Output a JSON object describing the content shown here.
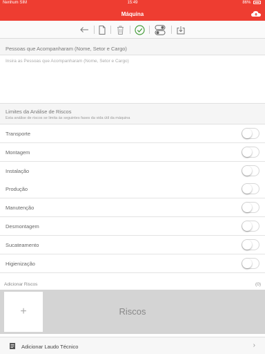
{
  "status_bar": {
    "carrier": "Nenhum SIM",
    "time": "15:49",
    "battery": "86%"
  },
  "nav": {
    "title": "Máquina",
    "cloud_icon": "cloud-upload-icon"
  },
  "toolbar": {
    "icons": [
      "arrow-left-icon",
      "document-icon",
      "trash-icon",
      "checkmark-icon",
      "toggles-icon",
      "download-icon"
    ]
  },
  "people_section": {
    "title": "Pessoas que Acompanharam (Nome, Setor e Cargo)",
    "placeholder": "Insira as Pessoas que Acompanharam (Nome, Setor e Cargo)",
    "value": ""
  },
  "limits_section": {
    "title": "Limites da Análise de Riscos",
    "subtitle": "Esta análise de riscos se limita às seguintes fases da vida útil da máquina"
  },
  "phases": [
    {
      "label": "Transporte",
      "on": false
    },
    {
      "label": "Montagem",
      "on": false
    },
    {
      "label": "Instalação",
      "on": false
    },
    {
      "label": "Produção",
      "on": false
    },
    {
      "label": "Manutenção",
      "on": false
    },
    {
      "label": "Desmontagem",
      "on": false
    },
    {
      "label": "Sucateamento",
      "on": false
    },
    {
      "label": "Higienização",
      "on": false
    }
  ],
  "risks": {
    "header": "Adicionar Riscos",
    "count": "(0)",
    "add_symbol": "+",
    "area_label": "Riscos"
  },
  "laudo": {
    "label": "Adicionar Laudo Técnico",
    "chevron": "›"
  },
  "colors": {
    "brand_red": "#ee3d31",
    "toggle_off_border": "#d8d8d8"
  }
}
